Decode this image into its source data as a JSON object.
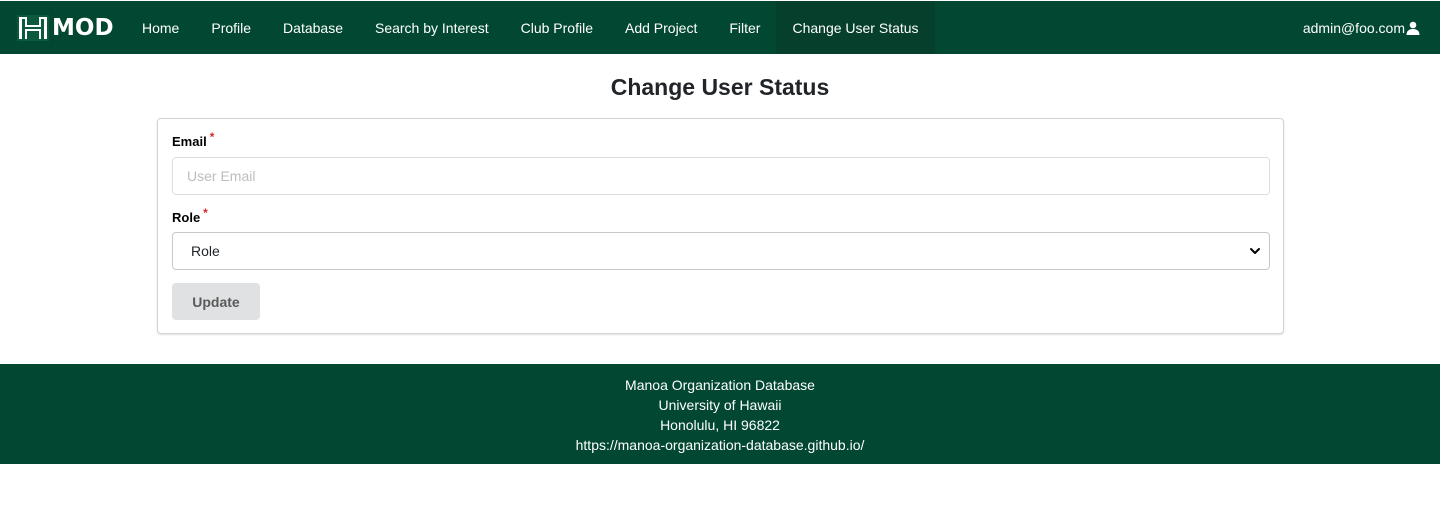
{
  "brand": {
    "text": "MOD"
  },
  "nav": {
    "items": [
      {
        "label": "Home"
      },
      {
        "label": "Profile"
      },
      {
        "label": "Database"
      },
      {
        "label": "Search by Interest"
      },
      {
        "label": "Club Profile"
      },
      {
        "label": "Add Project"
      },
      {
        "label": "Filter"
      },
      {
        "label": "Change User Status"
      }
    ],
    "active": "Change User Status",
    "user": "admin@foo.com"
  },
  "page": {
    "title": "Change User Status"
  },
  "form": {
    "email": {
      "label": "Email",
      "required_mark": "*",
      "placeholder": "User Email",
      "value": ""
    },
    "role": {
      "label": "Role",
      "required_mark": "*",
      "selected": "Role"
    },
    "submit_label": "Update"
  },
  "footer": {
    "lines": [
      "Manoa Organization Database",
      "University of Hawaii",
      "Honolulu, HI 96822",
      "https://manoa-organization-database.github.io/"
    ]
  },
  "colors": {
    "brand_green": "#024731",
    "required": "#db2828",
    "button_bg": "#e0e1e2"
  }
}
